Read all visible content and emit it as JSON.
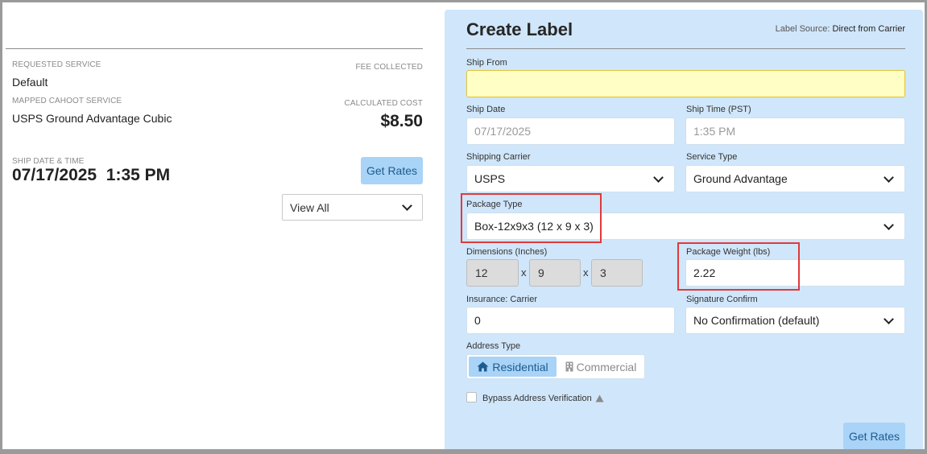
{
  "left": {
    "requested_service_label": "REQUESTED SERVICE",
    "requested_service_value": "Default",
    "fee_collected_label": "FEE COLLECTED",
    "mapped_service_label": "MAPPED CAHOOT SERVICE",
    "mapped_service_value": "USPS Ground Advantage Cubic",
    "calculated_cost_label": "CALCULATED COST",
    "calculated_cost_value": "$8.50",
    "ship_datetime_label": "SHIP DATE & TIME",
    "ship_datetime_value": "07/17/2025  1:35 PM",
    "get_rates_label": "Get Rates",
    "view_all_value": "View All"
  },
  "panel": {
    "title": "Create Label",
    "label_source_prefix": "Label Source:",
    "label_source_value": "Direct from Carrier",
    "ship_from_label": "Ship From",
    "ship_from_value": "",
    "ship_date_label": "Ship Date",
    "ship_date_value": "07/17/2025",
    "ship_time_label": "Ship Time (PST)",
    "ship_time_value": "1:35 PM",
    "carrier_label": "Shipping Carrier",
    "carrier_value": "USPS",
    "service_type_label": "Service Type",
    "service_type_value": "Ground Advantage",
    "package_type_label": "Package Type",
    "package_type_value": "Box-12x9x3 (12 x 9 x 3)",
    "dimensions_label": "Dimensions (Inches)",
    "dim_length": "12",
    "dim_width": "9",
    "dim_height": "3",
    "dim_separator": "x",
    "weight_label": "Package Weight (lbs)",
    "weight_value": "2.22",
    "insurance_label": "Insurance: Carrier",
    "insurance_value": "0",
    "signature_label": "Signature Confirm",
    "signature_value": "No Confirmation (default)",
    "address_type_label": "Address Type",
    "residential_label": "Residential",
    "commercial_label": "Commercial",
    "bypass_label": "Bypass Address Verification",
    "get_rates_label": "Get Rates"
  },
  "colors": {
    "panel_bg": "#d0e6fa",
    "button_bg": "#a9d3f7",
    "highlight_red": "#e03a3a",
    "ship_from_yellow": "#ffffc5"
  }
}
